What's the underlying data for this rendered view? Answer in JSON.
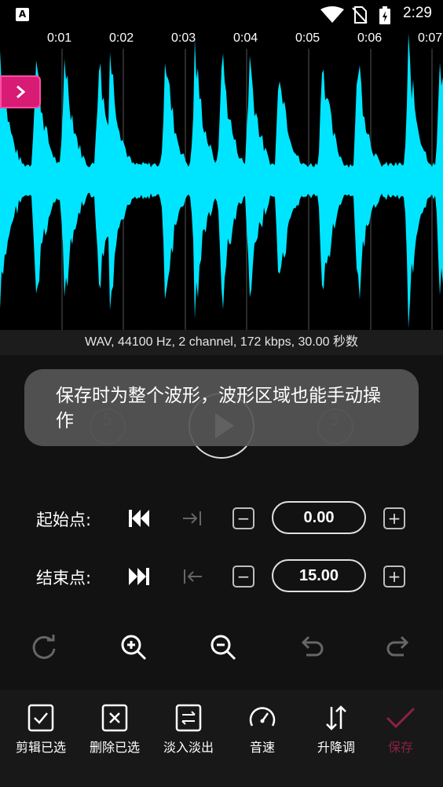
{
  "status_bar": {
    "time": "2:29",
    "app_icon_letter": "A"
  },
  "timeline": {
    "labels": [
      "0:01",
      "0:02",
      "0:03",
      "0:04",
      "0:05",
      "0:06",
      "0:07"
    ]
  },
  "waveform": {
    "color": "#00e5ff",
    "background": "#000000"
  },
  "info_bar": {
    "text": "WAV, 44100 Hz, 2 channel, 172 kbps, 30.00 秒数"
  },
  "playback": {
    "skip_back_label": "5",
    "skip_forward_label": "5"
  },
  "toast": {
    "text": "保存时为整个波形，波形区域也能手动操作"
  },
  "start_point": {
    "label": "起始点:",
    "value": "0.00"
  },
  "end_point": {
    "label": "结束点:",
    "value": "15.00"
  },
  "bottom_bar": {
    "items": [
      {
        "label": "剪辑已选",
        "icon": "checkbox-check-icon"
      },
      {
        "label": "删除已选",
        "icon": "checkbox-x-icon"
      },
      {
        "label": "淡入淡出",
        "icon": "fade-icon"
      },
      {
        "label": "音速",
        "icon": "speedometer-icon"
      },
      {
        "label": "升降调",
        "icon": "pitch-icon"
      },
      {
        "label": "保存",
        "icon": "check-icon"
      }
    ]
  },
  "colors": {
    "accent": "#d81b74",
    "wave": "#00e5ff",
    "save": "#8a2048"
  }
}
